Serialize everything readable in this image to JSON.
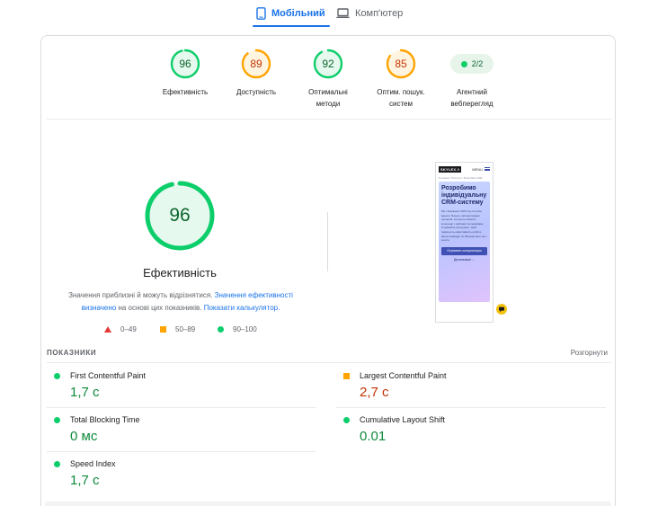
{
  "tabs": {
    "mobile": "Мобільний",
    "desktop": "Комп'ютер"
  },
  "gauges": [
    {
      "value": "96",
      "score": 96,
      "label": "Ефективність",
      "color": "#0cce6b",
      "bg": "#e6f9ee",
      "text": "#0d652d"
    },
    {
      "value": "89",
      "score": 89,
      "label": "Доступність",
      "color": "#ffa400",
      "bg": "#fff4e0",
      "text": "#c33300"
    },
    {
      "value": "92",
      "score": 92,
      "label": "Оптимальні методи",
      "color": "#0cce6b",
      "bg": "#e6f9ee",
      "text": "#0d652d"
    },
    {
      "value": "85",
      "score": 85,
      "label": "Оптим. пошук. систем",
      "color": "#ffa400",
      "bg": "#fff4e0",
      "text": "#c33300"
    }
  ],
  "pwa": {
    "value": "2/2",
    "label": "Агентний вебперегляд"
  },
  "main": {
    "value": "96",
    "score": 96,
    "title": "Ефективність",
    "note_pre": "Значення приблизні й можуть відрізнятися.",
    "note_link1": "Значення ефективності визначено",
    "note_mid": "на основі цих показників.",
    "note_link2": "Показати калькулятор."
  },
  "legend": {
    "bad": "0–49",
    "average": "50–89",
    "good": "90–100"
  },
  "preview": {
    "logo": "SKYLEX //",
    "menu": "MENU",
    "breadcrumb": "Головна / Послуги / Розробка CRM",
    "heading": "Розробимо індивідуальну CRM-систему",
    "text": "Ми створюємо CRM під потреби вашого бізнесу: автоматизація процесів, контроль клієнтів, інтеграції з сайтами та сервісами. Отримайте інструмент, який підвищить ефективність роботи вашої команди та збереже ваш час і кошти.",
    "button": "Отримати консультацію",
    "more": "Детальніше"
  },
  "metrics": {
    "title": "ПОКАЗНИКИ",
    "expand": "Розгорнути",
    "items": [
      {
        "label": "First Contentful Paint",
        "value": "1,7 с",
        "status": "good"
      },
      {
        "label": "Largest Contentful Paint",
        "value": "2,7 с",
        "status": "average"
      },
      {
        "label": "Total Blocking Time",
        "value": "0 мс",
        "status": "good"
      },
      {
        "label": "Cumulative Layout Shift",
        "value": "0.01",
        "status": "good"
      },
      {
        "label": "Speed Index",
        "value": "1,7 с",
        "status": "good"
      }
    ]
  },
  "colors": {
    "accent": "#1a73e8",
    "good": "#0cce6b",
    "average": "#ffa400",
    "bad": "#e53935"
  }
}
